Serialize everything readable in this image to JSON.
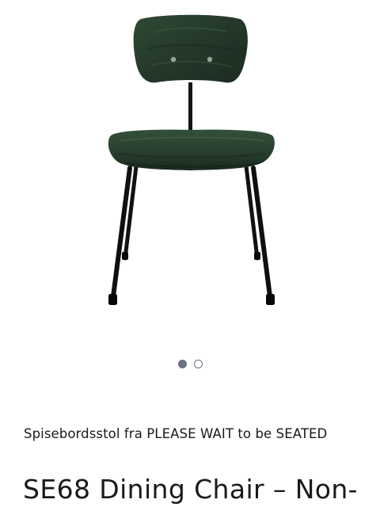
{
  "product": {
    "image_alt": "SE68 Dining Chair",
    "image_colors": {
      "wood": "#2b3d2d",
      "wood_dark": "#1e2c21",
      "wood_light": "#3f5a3f",
      "frame": "#111111"
    },
    "carousel": {
      "total": 2,
      "active_index": 1
    },
    "subtitle": "Spisebordsstol fra PLEASE WAIT to be SEATED",
    "title": "SE68 Dining Chair – Non-"
  }
}
